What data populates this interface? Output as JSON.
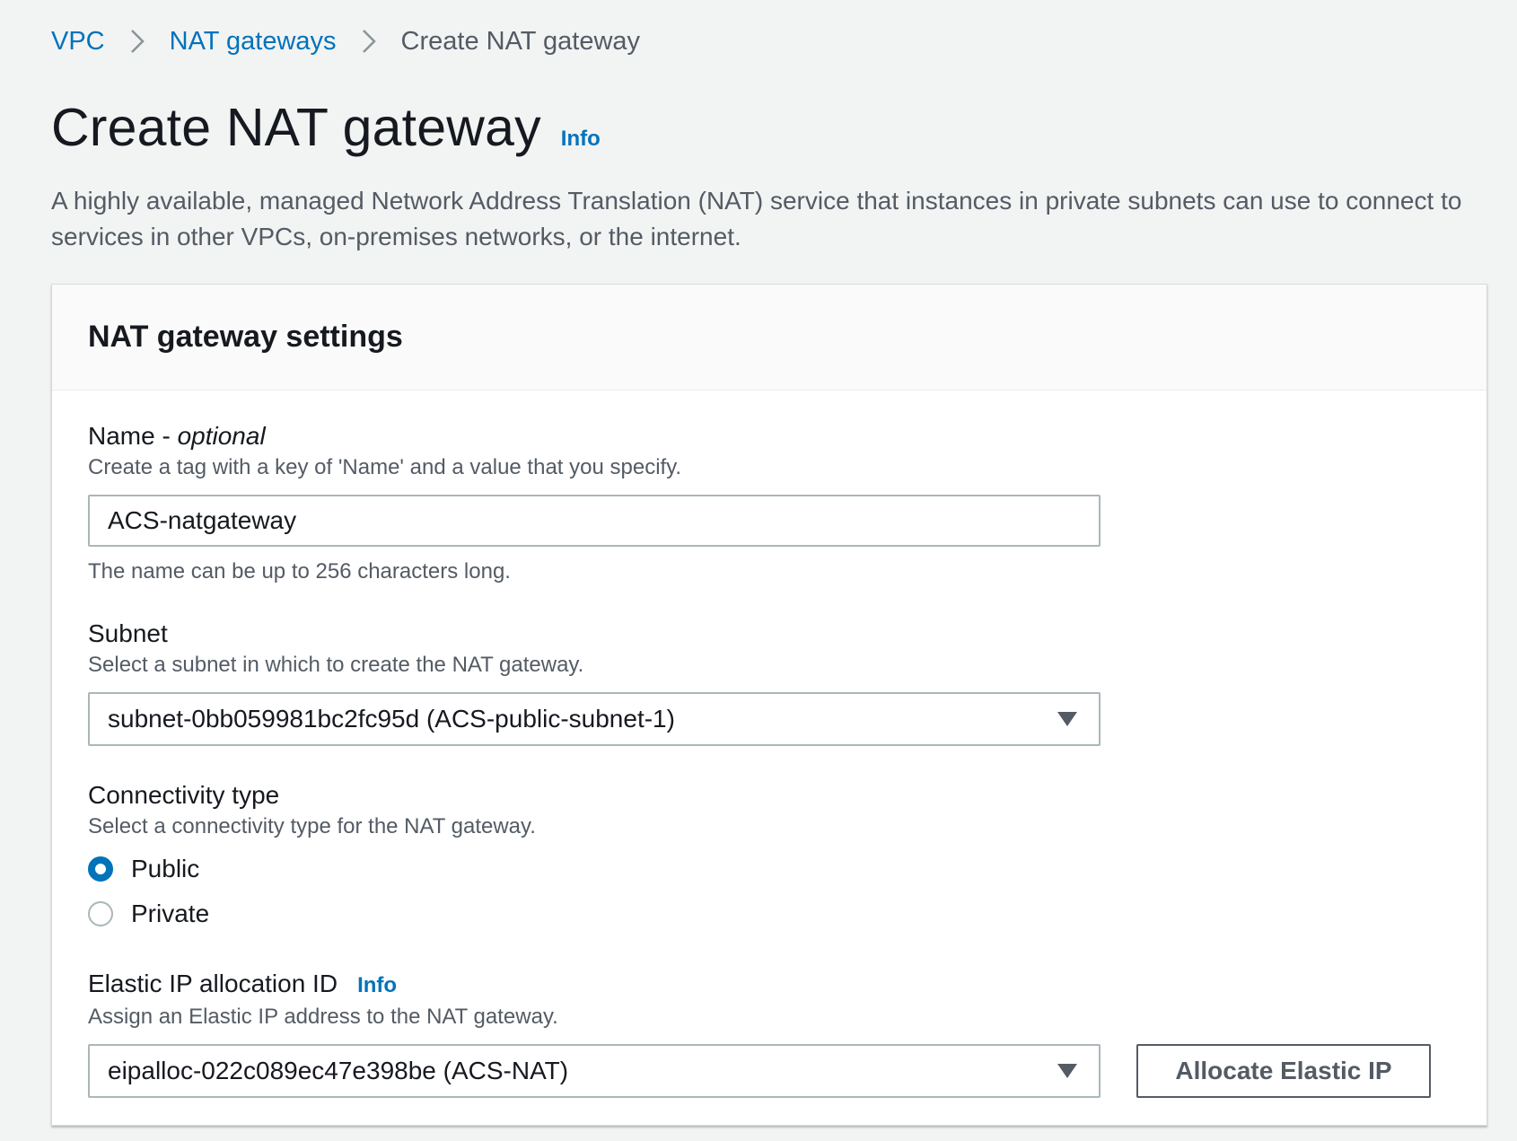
{
  "breadcrumb": {
    "items": [
      "VPC",
      "NAT gateways"
    ],
    "current": "Create NAT gateway"
  },
  "page": {
    "title": "Create NAT gateway",
    "info_label": "Info",
    "description": "A highly available, managed Network Address Translation (NAT) service that instances in private subnets can use to connect to services in other VPCs, on-premises networks, or the internet."
  },
  "panel": {
    "title": "NAT gateway settings"
  },
  "name_field": {
    "label": "Name -",
    "label_optional": "optional",
    "description": "Create a tag with a key of 'Name' and a value that you specify.",
    "value": "ACS-natgateway",
    "constraint": "The name can be up to 256 characters long."
  },
  "subnet_field": {
    "label": "Subnet",
    "description": "Select a subnet in which to create the NAT gateway.",
    "selected": "subnet-0bb059981bc2fc95d (ACS-public-subnet-1)"
  },
  "connectivity_field": {
    "label": "Connectivity type",
    "description": "Select a connectivity type for the NAT gateway.",
    "options": [
      {
        "label": "Public",
        "checked": true
      },
      {
        "label": "Private",
        "checked": false
      }
    ]
  },
  "eip_field": {
    "label": "Elastic IP allocation ID",
    "info_label": "Info",
    "description": "Assign an Elastic IP address to the NAT gateway.",
    "selected": "eipalloc-022c089ec47e398be (ACS-NAT)",
    "allocate_button": "Allocate Elastic IP"
  },
  "colors": {
    "link": "#0073bb",
    "text": "#16191f",
    "secondary_text": "#545b64",
    "background": "#f2f3f3",
    "border": "#aab7b8"
  }
}
